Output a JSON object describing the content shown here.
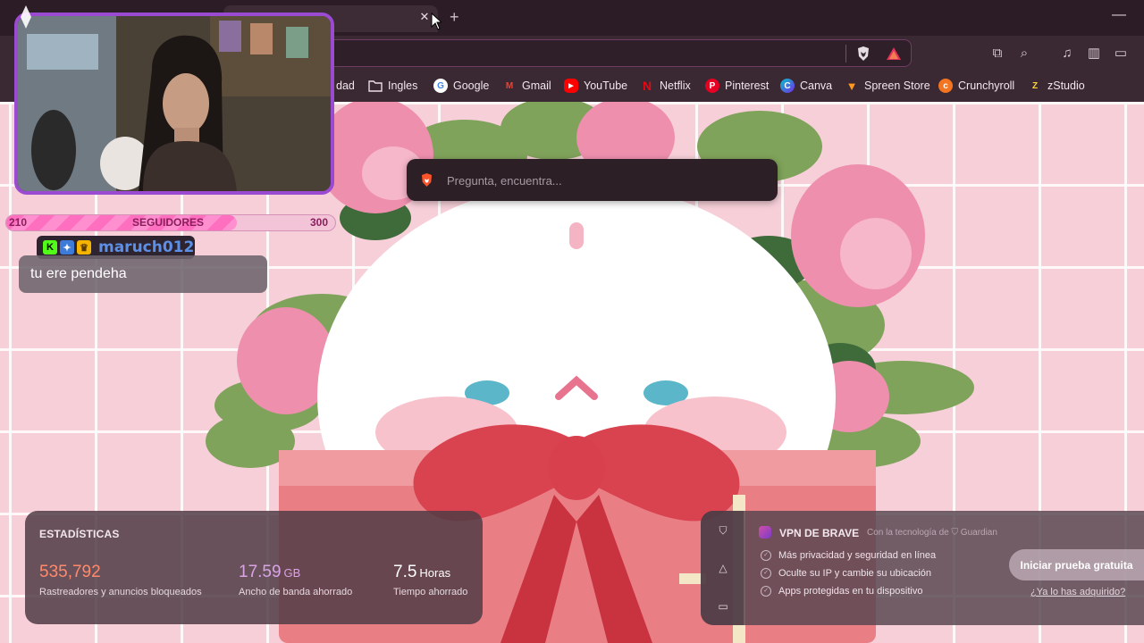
{
  "browser": {
    "close_tab_glyph": "✕",
    "new_tab_glyph": "+",
    "minimize_glyph": "—"
  },
  "bookmarks": [
    {
      "label": "dad",
      "icon": "bookmark-partial"
    },
    {
      "label": "Ingles",
      "icon": "folder-icon"
    },
    {
      "label": "Google",
      "icon": "google-icon"
    },
    {
      "label": "Gmail",
      "icon": "gmail-icon"
    },
    {
      "label": "YouTube",
      "icon": "youtube-icon"
    },
    {
      "label": "Netflix",
      "icon": "netflix-icon"
    },
    {
      "label": "Pinterest",
      "icon": "pinterest-icon"
    },
    {
      "label": "Canva",
      "icon": "canva-icon"
    },
    {
      "label": "Spreen Store",
      "icon": "spreen-store-icon"
    },
    {
      "label": "Crunchyroll",
      "icon": "crunchyroll-icon"
    },
    {
      "label": "zStudio",
      "icon": "zstudio-icon"
    }
  ],
  "search": {
    "placeholder": "Pregunta, encuentra..."
  },
  "stream": {
    "followers": {
      "current": "210",
      "label": "SEGUIDORES",
      "goal": "300",
      "fill_fraction": 0.7
    },
    "chat": {
      "username": "maruch012",
      "message": "tu ere pendeha"
    }
  },
  "stats": {
    "title": "ESTADÍSTICAS",
    "items": [
      {
        "value": "535,792",
        "unit": "",
        "label": "Rastreadores y anuncios bloqueados",
        "color": "#ff8a6b"
      },
      {
        "value": "17.59",
        "unit": "GB",
        "label": "Ancho de banda ahorrado",
        "color": "#d9a3e6"
      },
      {
        "value": "7.5",
        "unit": "Horas",
        "label": "Tiempo ahorrado",
        "color": "#ffffff"
      }
    ]
  },
  "vpn": {
    "title": "VPN DE BRAVE",
    "powered_by": "Con la tecnología de",
    "powered_brand": "Guardian",
    "features": [
      "Más privacidad y seguridad en línea",
      "Oculte su IP y cambie su ubicación",
      "Apps protegidas en tu dispositivo"
    ],
    "cta": "Iniciar prueba gratuita",
    "link": "¿Ya lo has adquirido?"
  },
  "colors": {
    "accent_purple": "#9b4bd1",
    "brave_orange": "#fb542b",
    "page_pink": "#f7cfd9"
  }
}
